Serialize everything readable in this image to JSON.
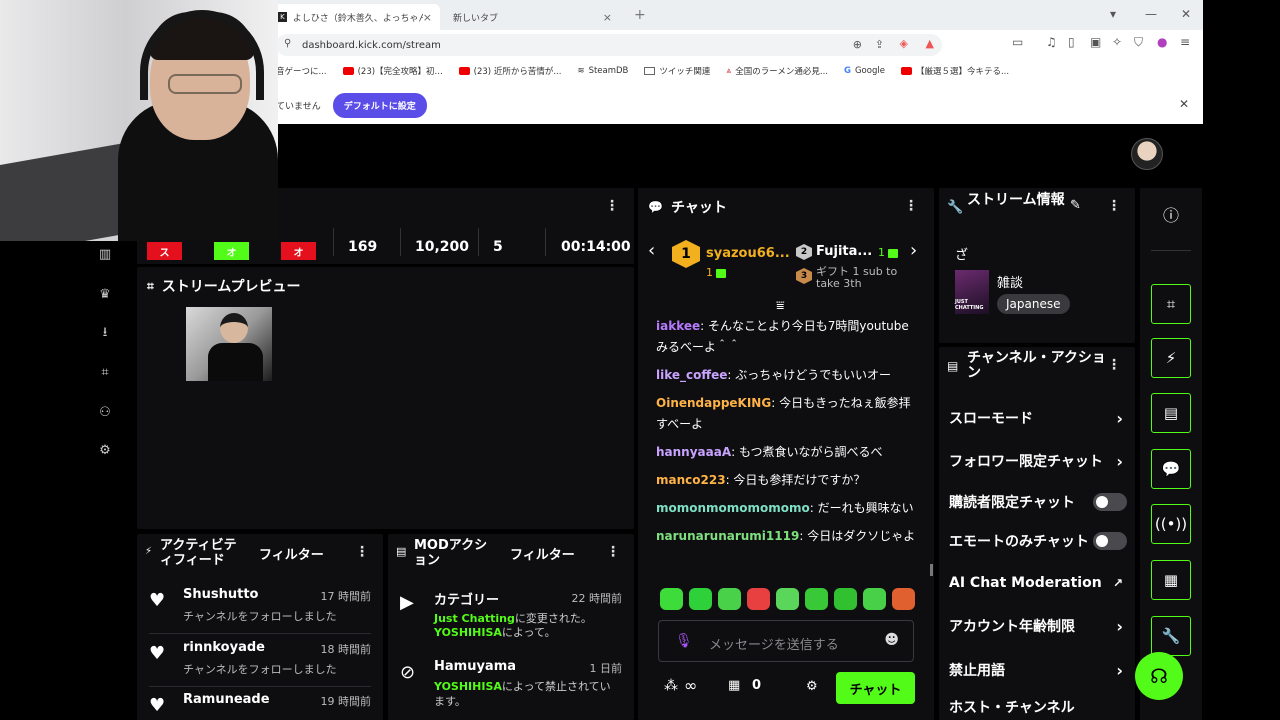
{
  "browser": {
    "tabs": [
      {
        "title": "よしひさ（鈴木善久、よっちゃん、よっち)",
        "favicon": "K"
      },
      {
        "title": "新しいタブ"
      }
    ],
    "url": "dashboard.kick.com/stream",
    "bookmarks": [
      {
        "label": "音ゲーつに...",
        "icon": "none"
      },
      {
        "label": "(23)【完全攻略】初...",
        "icon": "youtube"
      },
      {
        "label": "(23) 近所から苦情が...",
        "icon": "youtube"
      },
      {
        "label": "SteamDB",
        "icon": "steam"
      },
      {
        "label": "ツイッチ関連",
        "icon": "folder"
      },
      {
        "label": "全国のラーメン通必見...",
        "icon": "ramen"
      },
      {
        "label": "Google",
        "icon": "google"
      },
      {
        "label": "【厳選５選】今キテる...",
        "icon": "youtube"
      }
    ],
    "infobar_text": "ていません",
    "infobar_button": "デフォルトに設定"
  },
  "stats": {
    "badges": [
      {
        "label": "ス",
        "color": "#e5101d"
      },
      {
        "label": "オ",
        "color": "#53fc18"
      },
      {
        "label": "オ",
        "color": "#e5101d"
      }
    ],
    "viewers": "169",
    "followers": "10,200",
    "subs": "5",
    "uptime": "00:14:00"
  },
  "preview": {
    "title": "ストリームプレビュー"
  },
  "activity": {
    "title": "アクティビティフィード",
    "filter": "フィルター",
    "items": [
      {
        "name": "Shushutto",
        "time": "17 時間前",
        "desc": "チャンネルをフォローしました"
      },
      {
        "name": "rinnkoyade",
        "time": "18 時間前",
        "desc": "チャンネルをフォローしました"
      },
      {
        "name": "Ramuneade",
        "time": "19 時間前",
        "desc": ""
      }
    ]
  },
  "mod": {
    "title": "MODアクション",
    "filter": "フィルター",
    "items": [
      {
        "name": "カテゴリー",
        "time": "22 時間前",
        "line1_green": "Just Chatting",
        "line1_rest": "に変更された。",
        "line2_green": "YOSHIHISA",
        "line2_rest": "によって。"
      },
      {
        "name": "Hamuyama",
        "time": "1 日前",
        "line1_green": "YOSHIHISA",
        "line1_rest": "によって禁止されてい",
        "line2_green": "",
        "line2_rest": "ます。"
      }
    ]
  },
  "chat": {
    "title": "チャット",
    "leader1": {
      "rank": "1",
      "name": "syazou66...",
      "count": "1"
    },
    "leader2": {
      "rank": "2",
      "name": "Fujita...",
      "count": "1"
    },
    "leader3": {
      "rank": "3",
      "text": "ギフト 1 sub to take 3th"
    },
    "messages": [
      {
        "user": "iakkee",
        "color": "#b57bff",
        "text": "そんなことより今日も7時間youtubeみるべーよ＾＾"
      },
      {
        "user": "like_coffee",
        "color": "#c9a3ff",
        "text": "ぶっちゃけどうでもいいオー"
      },
      {
        "user": "OinendappeKING",
        "color": "#ffb347",
        "text": "今日もきったねぇ飯参拝すべーよ"
      },
      {
        "user": "hannyaaaA",
        "color": "#c9a3ff",
        "text": "もつ煮食いながら調べるべ"
      },
      {
        "user": "manco223",
        "color": "#ffb347",
        "text": "今日も参拝だけですか？"
      },
      {
        "user": "momonmomomomomo",
        "color": "#7ee0c3",
        "text": "だーれも興味ない"
      },
      {
        "user": "narunarunarumi1119",
        "color": "#7ee07e",
        "text": "今日はダクソじゃよ"
      }
    ],
    "emote_colors": [
      "#3ddc3a",
      "#2fd13a",
      "#4ad14a",
      "#e84040",
      "#5ad65a",
      "#38c838",
      "#30c030",
      "#48d048",
      "#e06030"
    ],
    "placeholder": "メッセージを送信する",
    "viewers_inf": "∞",
    "store_count": "0",
    "send": "チャット"
  },
  "info": {
    "title": "ストリーム情報",
    "stream_title": "ざ",
    "category": "雑談",
    "category_img_text": "JUST CHATTING",
    "language": "Japanese"
  },
  "actions": {
    "title": "チャンネル・アクション",
    "rows": [
      {
        "label": "スローモード",
        "kind": "chevron"
      },
      {
        "label": "フォロワー限定チャット",
        "kind": "chevron"
      },
      {
        "label": "購読者限定チャット",
        "kind": "toggle"
      },
      {
        "label": "エモートのみチャット",
        "kind": "toggle"
      },
      {
        "label": "AI Chat Moderation",
        "kind": "external"
      },
      {
        "label": "アカウント年齢制限",
        "kind": "chevron"
      },
      {
        "label": "禁止用語",
        "kind": "chevron"
      },
      {
        "label": "ホスト・チャンネル",
        "kind": "none"
      }
    ]
  },
  "right_rail": [
    "info-icon",
    "screen-icon",
    "lightning-icon",
    "document-icon",
    "chat-bubble-icon",
    "broadcast-icon",
    "layout-icon",
    "wrench-icon"
  ],
  "colors": {
    "accent": "#53fc18",
    "panel": "#0e0e10",
    "brand_purple": "#5b4ee8"
  }
}
